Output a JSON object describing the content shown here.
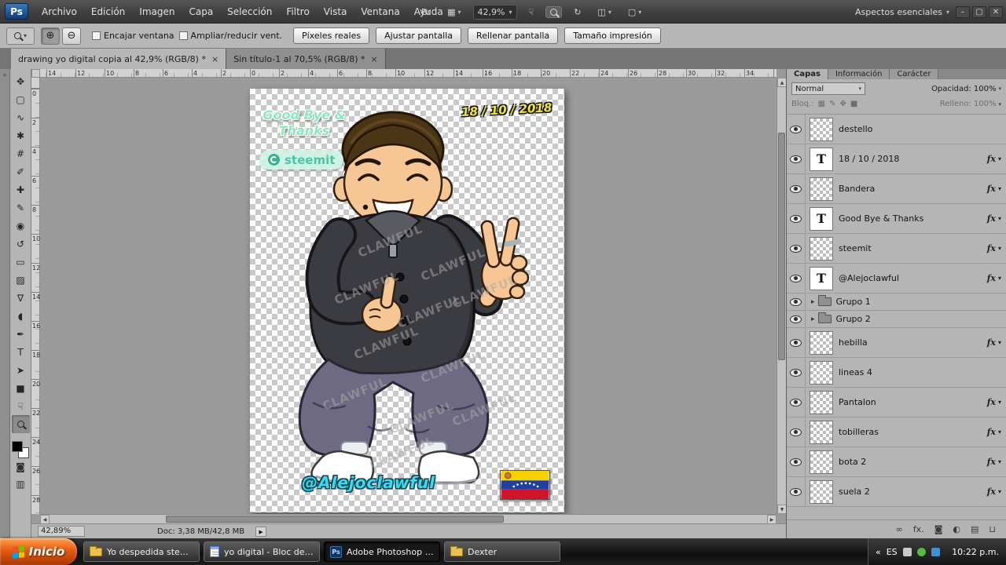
{
  "menubar": {
    "logo": "Ps",
    "menus": [
      "Archivo",
      "Edición",
      "Imagen",
      "Capa",
      "Selección",
      "Filtro",
      "Vista",
      "Ventana",
      "Ayuda"
    ],
    "tools": [
      {
        "name": "bridge-button",
        "glyph": "Br"
      },
      {
        "name": "view-extras-button",
        "glyph": "▦",
        "arrow": true
      },
      {
        "name": "zoom-level-box",
        "glyph": "42,9%",
        "arrow": true,
        "box": true
      },
      {
        "name": "hand-icon",
        "glyph": "☟"
      },
      {
        "name": "zoom-icon",
        "glyph": "mag",
        "pressed": true
      },
      {
        "name": "rotate-view-icon",
        "glyph": "↻"
      },
      {
        "name": "arrange-documents-button",
        "glyph": "◫",
        "arrow": true
      },
      {
        "name": "screen-mode-button",
        "glyph": "▢",
        "arrow": true
      }
    ],
    "workspace": "Aspectos esenciales",
    "window_buttons": [
      {
        "name": "minimize-button",
        "glyph": "–"
      },
      {
        "name": "maximize-button",
        "glyph": "▢"
      },
      {
        "name": "close-button",
        "glyph": "✕"
      }
    ]
  },
  "optionsbar": {
    "icon_buttons": [
      {
        "name": "zoom-in-button",
        "glyph": "⊕",
        "pressed": true
      },
      {
        "name": "zoom-out-button",
        "glyph": "⊖"
      }
    ],
    "checkboxes": [
      {
        "label": "Encajar ventana",
        "checked": false
      },
      {
        "label": "Ampliar/reducir vent.",
        "checked": false
      }
    ],
    "buttons": [
      "Píxeles reales",
      "Ajustar pantalla",
      "Rellenar pantalla",
      "Tamaño impresión"
    ]
  },
  "doc_tabs": [
    {
      "label": "drawing yo digital copia al 42,9% (RGB/8) *",
      "close": "×",
      "active": true
    },
    {
      "label": "Sin título-1 al 70,5% (RGB/8) *",
      "close": "×",
      "active": false
    }
  ],
  "toolbar": {
    "tools": [
      {
        "name": "move-tool",
        "glyph": "✥"
      },
      {
        "name": "rectangular-marquee-tool",
        "glyph": "▢"
      },
      {
        "name": "lasso-tool",
        "glyph": "∿"
      },
      {
        "name": "quick-selection-tool",
        "glyph": "✱"
      },
      {
        "name": "crop-tool",
        "glyph": "#"
      },
      {
        "name": "eyedropper-tool",
        "glyph": "✐"
      },
      {
        "name": "healing-brush-tool",
        "glyph": "✚"
      },
      {
        "name": "brush-tool",
        "glyph": "✎"
      },
      {
        "name": "clone-stamp-tool",
        "glyph": "◉"
      },
      {
        "name": "history-brush-tool",
        "glyph": "↺"
      },
      {
        "name": "eraser-tool",
        "glyph": "▭"
      },
      {
        "name": "gradient-tool",
        "glyph": "▨"
      },
      {
        "name": "blur-tool",
        "glyph": "∇"
      },
      {
        "name": "dodge-tool",
        "glyph": "◖"
      },
      {
        "name": "pen-tool",
        "glyph": "✒"
      },
      {
        "name": "type-tool",
        "glyph": "T"
      },
      {
        "name": "path-selection-tool",
        "glyph": "➤"
      },
      {
        "name": "shape-tool",
        "glyph": "■"
      },
      {
        "name": "hand-tool",
        "glyph": "☟"
      },
      {
        "name": "zoom-tool",
        "glyph": "mag",
        "active": true
      }
    ]
  },
  "rulers": {
    "h": [
      "14",
      "12",
      "10",
      "8",
      "6",
      "4",
      "2",
      "0",
      "2",
      "4",
      "6",
      "8",
      "10",
      "12",
      "14",
      "16",
      "18",
      "20",
      "22",
      "24",
      "26",
      "28",
      "30",
      "32",
      "34"
    ],
    "v": [
      "0",
      "2",
      "4",
      "6",
      "8",
      "10",
      "12",
      "14",
      "16",
      "18",
      "20",
      "22",
      "24",
      "26",
      "28"
    ]
  },
  "canvas": {
    "goodbye_line1": "Good Bye &",
    "goodbye_line2": "Thanks",
    "steemit": "steemit",
    "date": "18 / 10 / 2018",
    "username": "@Alejoclawful",
    "watermark": "CLAWFUL"
  },
  "colors": {
    "flag_yellow": "#f7d100",
    "flag_blue": "#203fa0",
    "flag_red": "#cf142b",
    "username_cyan": "#3fd9ef",
    "date_yellow": "#f2e33b",
    "goodbye_mint": "#8fe6c0",
    "steemit_teal": "#4bc4a8"
  },
  "statusbar": {
    "zoom": "42,89%",
    "doc": "Doc: 3,38 MB/42,8 MB"
  },
  "panels": {
    "tabs": [
      {
        "label": "Capas",
        "active": true
      },
      {
        "label": "Información",
        "active": false
      },
      {
        "label": "Carácter",
        "active": false
      }
    ],
    "blend_mode": "Normal",
    "opacity_label": "Opacidad:",
    "opacity_value": "100%",
    "lock_label": "Bloq.:",
    "lock_icons": [
      {
        "name": "lock-transparency-icon",
        "glyph": "▦"
      },
      {
        "name": "lock-pixels-icon",
        "glyph": "✎"
      },
      {
        "name": "lock-position-icon",
        "glyph": "✥"
      },
      {
        "name": "lock-all-icon",
        "glyph": "■"
      }
    ],
    "fill_label": "Relleno:",
    "fill_value": "100%",
    "fx_label": "fx",
    "layers": [
      {
        "name": "destello",
        "kind": "image",
        "fx": false
      },
      {
        "name": "18 / 10 / 2018",
        "kind": "text",
        "fx": true
      },
      {
        "name": "Bandera",
        "kind": "image",
        "fx": true
      },
      {
        "name": "Good Bye & Thanks",
        "kind": "text",
        "fx": true
      },
      {
        "name": "steemit",
        "kind": "image",
        "fx": true
      },
      {
        "name": "@Alejoclawful",
        "kind": "text",
        "fx": true
      },
      {
        "name": "Grupo 1",
        "kind": "group",
        "fx": false
      },
      {
        "name": "Grupo 2",
        "kind": "group",
        "fx": false
      },
      {
        "name": "hebilla",
        "kind": "image",
        "fx": true
      },
      {
        "name": "lineas 4",
        "kind": "image",
        "fx": false
      },
      {
        "name": "Pantalon",
        "kind": "image",
        "fx": true
      },
      {
        "name": "tobilleras",
        "kind": "image",
        "fx": true
      },
      {
        "name": "bota 2",
        "kind": "image",
        "fx": true
      },
      {
        "name": "suela 2",
        "kind": "image",
        "fx": true
      }
    ],
    "bottom_icons": [
      {
        "name": "link-layers-icon",
        "glyph": "∞"
      },
      {
        "name": "layer-style-icon",
        "glyph": "fx."
      },
      {
        "name": "layer-mask-icon",
        "glyph": "◙"
      },
      {
        "name": "adjustment-layer-icon",
        "glyph": "◐"
      },
      {
        "name": "new-group-icon",
        "glyph": "▤"
      },
      {
        "name": "delete-layer-icon",
        "glyph": "⊔"
      }
    ]
  },
  "taskbar": {
    "start": "Inicio",
    "items": [
      {
        "label": "Yo despedida steemit",
        "icon": "folder",
        "active": false
      },
      {
        "label": "yo digital - Bloc de no...",
        "icon": "notepad",
        "active": false
      },
      {
        "label": "Adobe Photoshop CS...",
        "icon": "ps",
        "active": true
      },
      {
        "label": "Dexter",
        "icon": "folder",
        "active": false
      }
    ],
    "tray": {
      "chevron": "«",
      "lang": "ES",
      "time": "10:22 p.m."
    }
  }
}
